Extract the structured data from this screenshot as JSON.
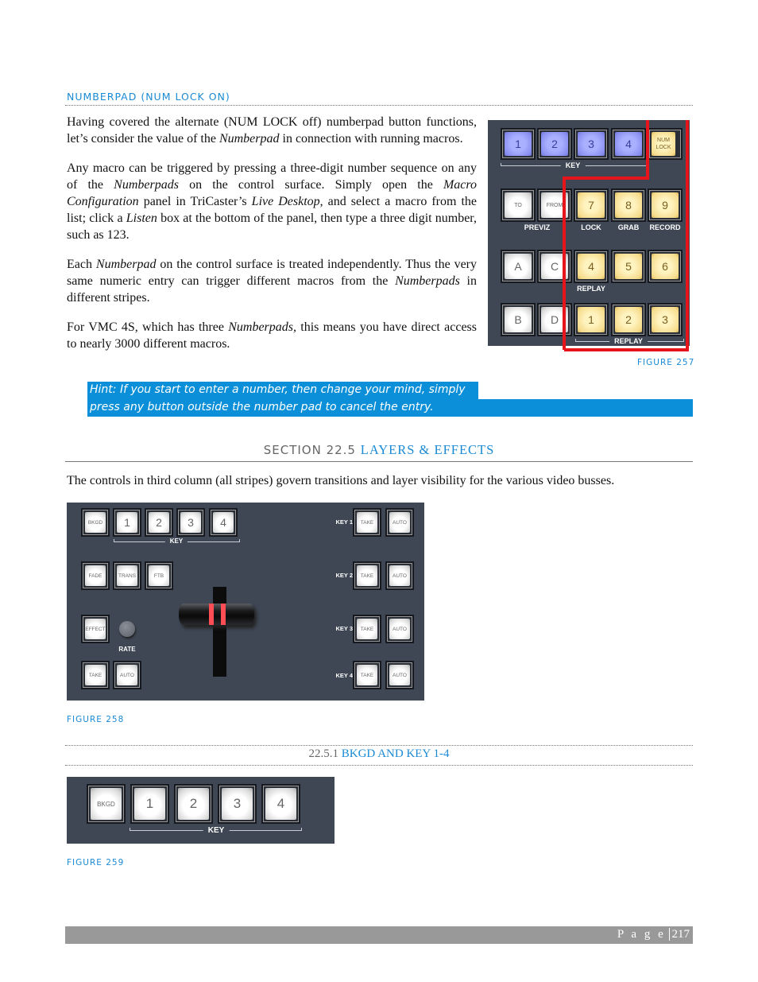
{
  "numberpad_section": {
    "heading": "NUMBERPAD (NUM LOCK ON)",
    "paragraphs": {
      "p1": {
        "a": "Having covered the alternate (NUM LOCK off) numberpad button functions, let’s consider the value of the ",
        "b": "Numberpad",
        "c": " in connection with running macros."
      },
      "p2": {
        "a": "Any macro can be triggered by pressing a three-digit number sequence on any of the ",
        "b": "Numberpads",
        "c": " on the control surface. Simply open the ",
        "d": "Macro Configuration",
        "e": " panel in TriCaster’s ",
        "f": "Live Desktop",
        "g": ", and select a macro from the list; click a ",
        "h": "Listen",
        "i": " box at the bottom of the panel, then type a three digit number, such as 123."
      },
      "p3": {
        "a": "Each ",
        "b": "Numberpad",
        "c": " on the control surface is treated independently.  Thus the very same numeric entry can trigger different macros from the ",
        "d": "Numberpads",
        "e": " in different stripes."
      },
      "p4": {
        "a": "For VMC 4S, which has three ",
        "b": "Numberpads",
        "c": ", this means you have direct access to nearly 3000 different macros."
      }
    },
    "figure_caption": "FIGURE 257",
    "hint_line1": "Hint: If you start to enter a number, then change your mind, simply",
    "hint_line2": "press any button outside the number pad to cancel the entry.",
    "figure": {
      "row1": [
        "1",
        "2",
        "3",
        "4",
        "NUM LOCK"
      ],
      "row1_group_label": "KEY",
      "row2": [
        "TO",
        "FROM",
        "7",
        "8",
        "9"
      ],
      "row2_labels": [
        "PREVIZ",
        "LOCK",
        "GRAB",
        "RECORD"
      ],
      "row3": [
        "A",
        "C",
        "4",
        "5",
        "6"
      ],
      "row3_label": "REPLAY",
      "row4": [
        "B",
        "D",
        "1",
        "2",
        "3"
      ],
      "row4_group_label": "REPLAY",
      "highlight_color": "#e8141b"
    }
  },
  "section_22_5": {
    "prefix": "SECTION 22.5",
    "title": "LAYERS & EFFECTS",
    "body": "The controls in third column (all stripes) govern transitions and layer visibility for the various video busses.",
    "figure_caption": "FIGURE 258",
    "figure": {
      "row1": [
        "BKGD",
        "1",
        "2",
        "3",
        "4"
      ],
      "row1_group_label": "KEY",
      "row2": [
        "FADE",
        "TRANS",
        "FTB"
      ],
      "effect": "EFFECT",
      "rate_label": "RATE",
      "take": "TAKE",
      "auto": "AUTO",
      "keys": [
        {
          "label": "KEY 1",
          "take": "TAKE",
          "auto": "AUTO"
        },
        {
          "label": "KEY 2",
          "take": "TAKE",
          "auto": "AUTO"
        },
        {
          "label": "KEY 3",
          "take": "TAKE",
          "auto": "AUTO"
        },
        {
          "label": "KEY 4",
          "take": "TAKE",
          "auto": "AUTO"
        }
      ]
    }
  },
  "subsection_22_5_1": {
    "prefix": "22.5.1",
    "title": "BKGD AND KEY 1-4",
    "figure_caption": "FIGURE 259",
    "figure": {
      "buttons": [
        "BKGD",
        "1",
        "2",
        "3",
        "4"
      ],
      "group_label": "KEY"
    }
  },
  "footer": {
    "page_label": "P a g e",
    "page_number": "217"
  },
  "colors": {
    "accent": "#1a8ad4",
    "hint_bg": "#0a8fd8",
    "panel_bg": "#3f4755",
    "footer_bg": "#999999"
  }
}
